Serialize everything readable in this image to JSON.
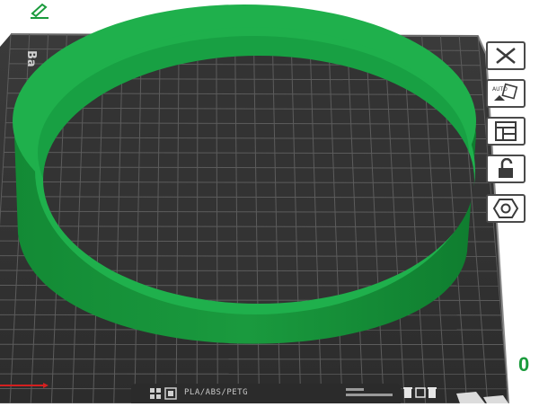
{
  "toolbar": {
    "close_icon": "close-icon",
    "auto_icon": "auto-arrange-icon",
    "auto_label": "AUTO",
    "layout_icon": "layout-icon",
    "lock_icon": "lock-open-icon",
    "settings_icon": "hexagon-nut-icon"
  },
  "bed": {
    "watermark": "Ba",
    "plate_label": "PLA/ABS/PETG"
  },
  "status": {
    "counter": "0"
  },
  "colors": {
    "ring": "#21a94a",
    "ring_dark": "#0f8a34",
    "bed": "#343434",
    "grid": "#5a5a5a",
    "accent_red": "#d42020"
  }
}
